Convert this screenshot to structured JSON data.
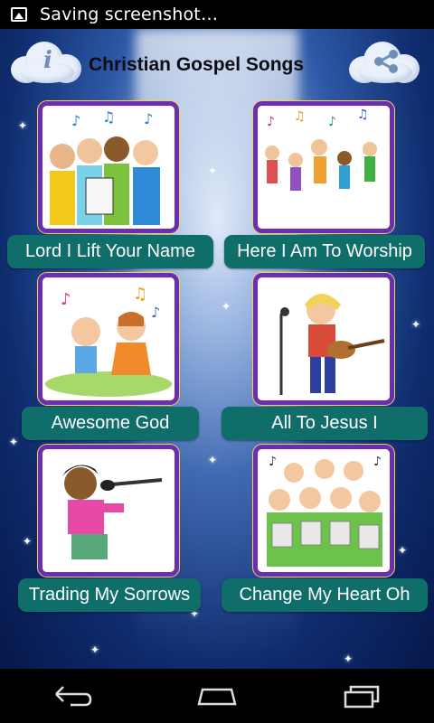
{
  "status_bar": {
    "notification_text": "Saving screenshot…"
  },
  "header": {
    "title": "Christian Gospel Songs",
    "info_icon": "info-icon",
    "share_icon": "share-icon"
  },
  "songs": [
    {
      "label": "Lord I Lift Your Name"
    },
    {
      "label": "Here I Am To Worship"
    },
    {
      "label": "Awesome God"
    },
    {
      "label": "All To Jesus I"
    },
    {
      "label": "Trading My Sorrows"
    },
    {
      "label": "Change My Heart Oh"
    }
  ],
  "nav": {
    "back": "back-icon",
    "home": "home-icon",
    "recents": "recents-icon"
  },
  "colors": {
    "button": "#0f6e6a",
    "tile_border": "#6a2fb0",
    "tile_inner": "#f2c94c",
    "background": "#0f2c6e"
  }
}
